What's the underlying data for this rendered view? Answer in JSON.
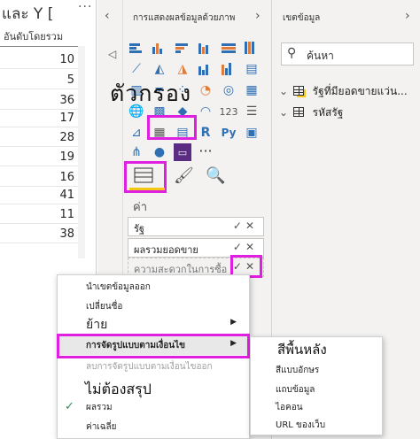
{
  "table": {
    "title": "และ Y [",
    "more": "···",
    "column_header": "อันดับโดยรวม",
    "values": [
      "10",
      "5",
      "36",
      "17",
      "28",
      "19",
      "16",
      "41",
      "11",
      "38"
    ]
  },
  "visualizations": {
    "title": "การแสดงผลข้อมูลด้วยภาพ",
    "collapse_left": "‹",
    "expand_right": "›",
    "filter_tab": "◁",
    "overlay_label": "ตัวกรอง",
    "icons": [
      "stacked-bar-chart-icon",
      "stacked-column-chart-icon",
      "clustered-bar-chart-icon",
      "clustered-column-chart-icon",
      "100-bar-chart-icon",
      "100-column-chart-icon",
      "line-chart-icon",
      "area-chart-icon",
      "stacked-area-chart-icon",
      "line-column-chart-icon",
      "line-stacked-column-chart-icon",
      "ribbon-chart-icon",
      "waterfall-chart-icon",
      "funnel-chart-icon",
      "scatter-chart-icon",
      "pie-chart-icon",
      "donut-chart-icon",
      "treemap-icon",
      "map-icon",
      "filled-map-icon",
      "shape-map-icon",
      "gauge-icon",
      "card-icon",
      "multi-row-card-icon",
      "kpi-icon",
      "table-icon",
      "matrix-icon",
      "r-visual-icon",
      "python-visual-icon",
      "key-influencers-icon",
      "decomposition-tree-icon",
      "qa-icon",
      "smart-narrative-icon",
      "more-visuals-icon"
    ],
    "values_label": "ค่า",
    "wells": [
      {
        "label": "รัฐ"
      },
      {
        "label": "ผลรวมยอดขาย"
      },
      {
        "label": "ความสะดวกในการซื้อ"
      }
    ],
    "well_controls": "✓✕"
  },
  "fields": {
    "title": "เขตข้อมูล",
    "expand": "›",
    "search_placeholder": "ค้นหา",
    "items": [
      {
        "caret": "⌄",
        "label": "รัฐที่มียอดขายแว่น..."
      },
      {
        "caret": "⌄",
        "label": "รหัสรัฐ"
      }
    ]
  },
  "context_menu": {
    "items": [
      {
        "label": "นำเขตข้อมูลออก",
        "arrow": "",
        "check": "",
        "disabled": false
      },
      {
        "label": "เปลี่ยนชื่อ",
        "arrow": "",
        "check": "",
        "disabled": false
      },
      {
        "label": "ย้าย",
        "arrow": "▶",
        "check": "",
        "disabled": false
      },
      {
        "label": "การจัดรูปแบบตามเงื่อนไข",
        "arrow": "▶",
        "check": "",
        "disabled": false
      },
      {
        "label": "ลบการจัดรูปแบบตามเงื่อนไขออก",
        "arrow": "",
        "check": "",
        "disabled": true
      },
      {
        "label": "ผลรวม",
        "arrow": "",
        "check": "✓",
        "disabled": false
      },
      {
        "label": "ค่าเฉลี่ย",
        "arrow": "",
        "check": "",
        "disabled": false
      }
    ],
    "big_label": "ไม่ต้องสรุป"
  },
  "submenu": {
    "big_label": "สีพื้นหลัง",
    "items": [
      "สีแบบอักษร",
      "แถบข้อมูล",
      "ไอคอน",
      "URL ของเว็บ"
    ]
  },
  "colors": {
    "highlight": "#e020e0",
    "accent": "#f2c811",
    "chart_blue": "#2f6fb3"
  }
}
